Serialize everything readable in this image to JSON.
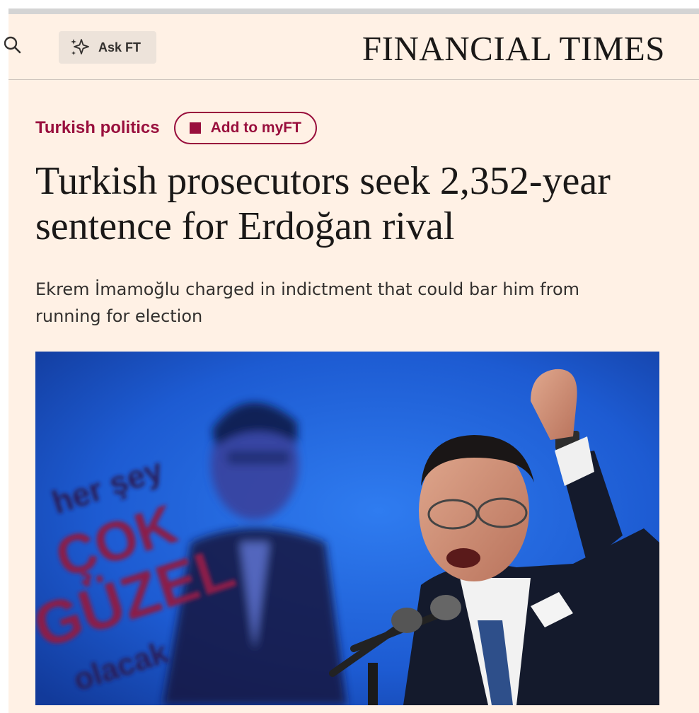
{
  "header": {
    "search_icon": "search-icon",
    "ask_ft_label": "Ask FT",
    "ask_ft_icon": "sparkle-icon",
    "masthead": "FINANCIAL TIMES"
  },
  "article": {
    "topic": "Turkish politics",
    "add_to_myft_label": "Add to myFT",
    "headline": "Turkish prosecutors seek 2,352-year sentence for Erdoğan rival",
    "standfirst": "Ekrem İmamoğlu charged in indictment that could bar him from running for election",
    "image": {
      "poster_text": [
        "her şey",
        "ÇOK",
        "GÜZEL",
        "olacak"
      ]
    }
  },
  "colors": {
    "background": "#fff1e5",
    "claret": "#990f3d",
    "text": "#1a1817",
    "photo_blue": "#1f5fd6"
  }
}
